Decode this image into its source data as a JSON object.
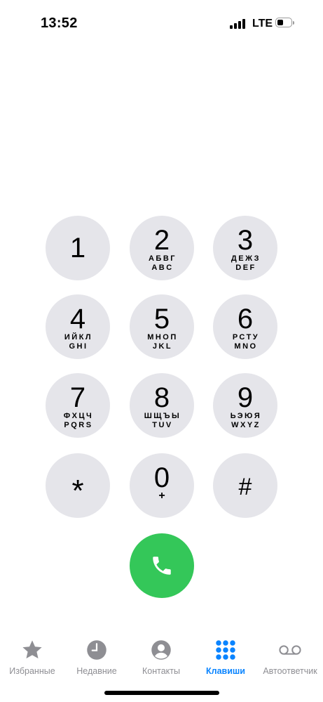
{
  "status_bar": {
    "time": "13:52",
    "network": "LTE",
    "battery_level": 0.3
  },
  "keypad": {
    "keys": [
      {
        "digit": "1",
        "cyrillic": "",
        "latin": ""
      },
      {
        "digit": "2",
        "cyrillic": "АБВГ",
        "latin": "ABC"
      },
      {
        "digit": "3",
        "cyrillic": "ДЕЖЗ",
        "latin": "DEF"
      },
      {
        "digit": "4",
        "cyrillic": "ИЙКЛ",
        "latin": "GHI"
      },
      {
        "digit": "5",
        "cyrillic": "МНОП",
        "latin": "JKL"
      },
      {
        "digit": "6",
        "cyrillic": "РСТУ",
        "latin": "MNO"
      },
      {
        "digit": "7",
        "cyrillic": "ФХЦЧ",
        "latin": "PQRS"
      },
      {
        "digit": "8",
        "cyrillic": "ШЩЪЫ",
        "latin": "TUV"
      },
      {
        "digit": "9",
        "cyrillic": "ЬЭЮЯ",
        "latin": "WXYZ"
      },
      {
        "digit": "*",
        "cyrillic": "",
        "latin": ""
      },
      {
        "digit": "0",
        "cyrillic": "+",
        "latin": ""
      },
      {
        "digit": "#",
        "cyrillic": "",
        "latin": ""
      }
    ]
  },
  "call_button": {
    "icon": "phone-icon",
    "color": "#34c759"
  },
  "tab_bar": {
    "accent": "#0a84ff",
    "inactive": "#8e8e93",
    "items": [
      {
        "label": "Избранные",
        "icon": "star-icon",
        "active": false
      },
      {
        "label": "Недавние",
        "icon": "clock-icon",
        "active": false
      },
      {
        "label": "Контакты",
        "icon": "contact-icon",
        "active": false
      },
      {
        "label": "Клавиши",
        "icon": "keypad-icon",
        "active": true
      },
      {
        "label": "Автоответчик",
        "icon": "voicemail-icon",
        "active": false
      }
    ]
  }
}
